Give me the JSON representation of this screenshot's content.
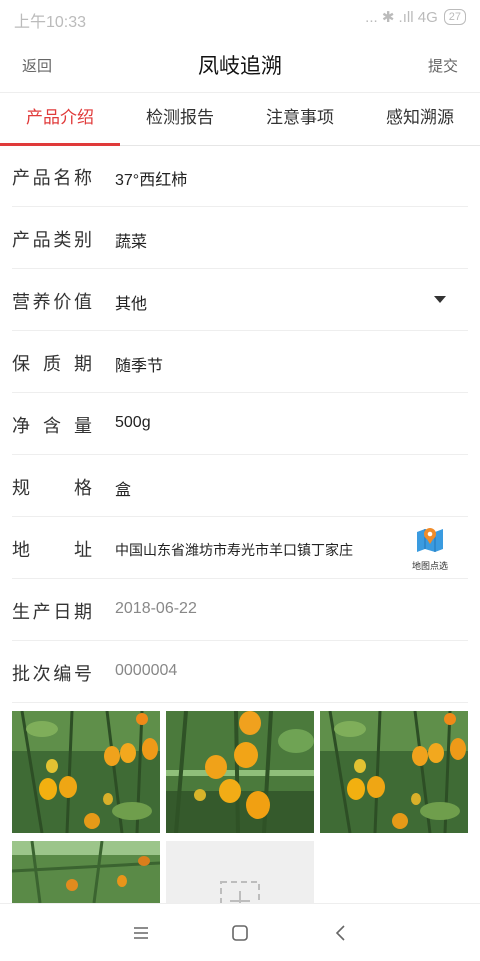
{
  "status_bar": {
    "time": "上午10:33",
    "network": "...  ✱  .ıll 4G",
    "battery": "27"
  },
  "header": {
    "back_label": "返回",
    "title": "凤岐追溯",
    "submit_label": "提交"
  },
  "tabs": [
    {
      "label": "产品介绍",
      "active": true
    },
    {
      "label": "检测报告",
      "active": false
    },
    {
      "label": "注意事项",
      "active": false
    },
    {
      "label": "感知溯源",
      "active": false
    }
  ],
  "form": {
    "product_name": {
      "label": "产品名称",
      "value": "37°西红柿"
    },
    "product_category": {
      "label": "产品类别",
      "value": "蔬菜"
    },
    "nutrition_value": {
      "label": "营养价值",
      "value": "其他"
    },
    "shelf_life": {
      "label": "保质期",
      "value": "随季节"
    },
    "net_content": {
      "label": "净含量",
      "value": "500g"
    },
    "specification": {
      "label": "规格",
      "value": "盒"
    },
    "address": {
      "label": "地址",
      "value": "中国山东省潍坊市寿光市羊口镇丁家庄",
      "map_pick_label": "地图点选"
    },
    "production_date": {
      "label": "生产日期",
      "value": "2018-06-22"
    },
    "batch_number": {
      "label": "批次编号",
      "value": "0000004"
    }
  },
  "colors": {
    "accent": "#e03a3a",
    "map_icon": "#2b8fd8"
  },
  "icons": {
    "map_pick": "map-marker-icon",
    "add_photo": "add-photo-icon",
    "nav_menu": "menu-icon",
    "nav_home": "home-square-icon",
    "nav_back": "back-chevron-icon"
  }
}
